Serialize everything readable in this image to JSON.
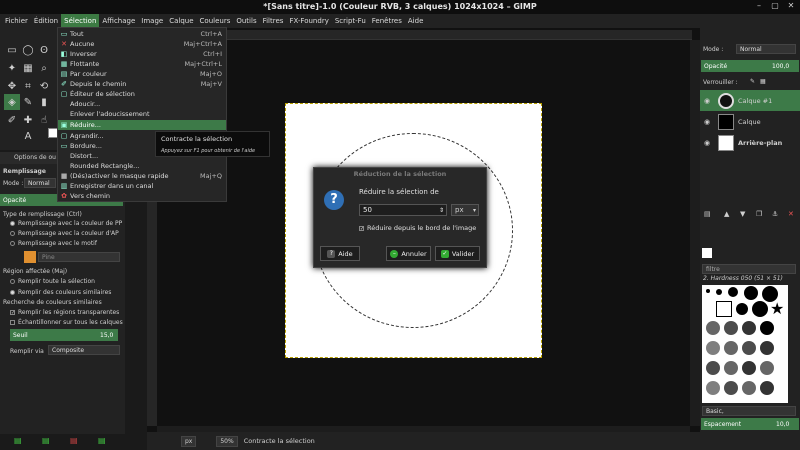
{
  "window": {
    "title": "*[Sans titre]-1.0 (Couleur RVB, 3 calques) 1024x1024 – GIMP"
  },
  "menubar": [
    "Fichier",
    "Édition",
    "Sélection",
    "Affichage",
    "Image",
    "Calque",
    "Couleurs",
    "Outils",
    "Filtres",
    "FX-Foundry",
    "Script-Fu",
    "Fenêtres",
    "Aide"
  ],
  "menubar_active": "Sélection",
  "selection_menu": [
    {
      "label": "Tout",
      "shortcut": "Ctrl+A"
    },
    {
      "label": "Aucune",
      "shortcut": "Maj+Ctrl+A"
    },
    {
      "label": "Inverser",
      "shortcut": "Ctrl+I"
    },
    {
      "label": "Flottante",
      "shortcut": "Maj+Ctrl+L"
    },
    {
      "label": "Par couleur",
      "shortcut": "Maj+O"
    },
    {
      "label": "Depuis le chemin",
      "shortcut": "Maj+V"
    },
    {
      "label": "Éditeur de sélection",
      "shortcut": ""
    },
    {
      "label": "Adoucir...",
      "shortcut": ""
    },
    {
      "label": "Enlever l'adoucissement",
      "shortcut": ""
    },
    {
      "label": "Réduire...",
      "shortcut": ""
    },
    {
      "label": "Agrandir...",
      "shortcut": ""
    },
    {
      "label": "Bordure...",
      "shortcut": ""
    },
    {
      "label": "Distort...",
      "shortcut": ""
    },
    {
      "label": "Rounded Rectangle...",
      "shortcut": ""
    },
    {
      "label": "(Dés)activer le masque rapide",
      "shortcut": "Maj+Q"
    },
    {
      "label": "Enregistrer dans un canal",
      "shortcut": ""
    },
    {
      "label": "Vers chemin",
      "shortcut": ""
    }
  ],
  "tooltip": {
    "title": "Contracte la sélection",
    "hint": "Appuyez sur F1 pour obtenir de l'aide"
  },
  "tool_options": {
    "tab": "Options de ou",
    "title": "Remplissage",
    "mode_label": "Mode :",
    "mode_value": "Normal",
    "opacity_label": "Opacité",
    "fill_type_label": "Type de remplissage (Ctrl)",
    "fill_types": [
      "Remplissage avec la couleur de PP",
      "Remplissage avec la couleur d'AP",
      "Remplissage avec le motif"
    ],
    "pattern_name": "Pine",
    "affected_label": "Région affectée (Maj)",
    "affected": [
      "Remplir toute la sélection",
      "Remplir des couleurs similaires"
    ],
    "similar_label": "Recherche de couleurs similaires",
    "checks": [
      "Remplir les régions transparentes",
      "Échantillonner sur tous les calques"
    ],
    "threshold_label": "Seuil",
    "threshold_value": "15,0",
    "fill_by_label": "Remplir via",
    "fill_by_value": "Composite"
  },
  "dialog": {
    "title": "Réduction de la sélection",
    "label": "Réduire la sélection de",
    "value": "50",
    "unit": "px",
    "checkbox": "Réduire depuis le bord de l'image",
    "btn_help": "Aide",
    "btn_cancel": "Annuler",
    "btn_ok": "Valider"
  },
  "statusbar": {
    "unit": "px",
    "zoom": "50%",
    "message": "Contracte la sélection"
  },
  "layers_panel": {
    "mode_label": "Mode :",
    "mode_value": "Normal",
    "opacity_label": "Opacité",
    "opacity_value": "100,0",
    "lock_label": "Verrouiller :",
    "layers": [
      "Calque #1",
      "Calque",
      "Arrière-plan"
    ]
  },
  "brushes_panel": {
    "filter": "filtre",
    "brush_name": "2. Hardness 050 (51 × 51)",
    "preset": "Basic,",
    "spacing_label": "Espacement",
    "spacing_value": "10,0"
  }
}
